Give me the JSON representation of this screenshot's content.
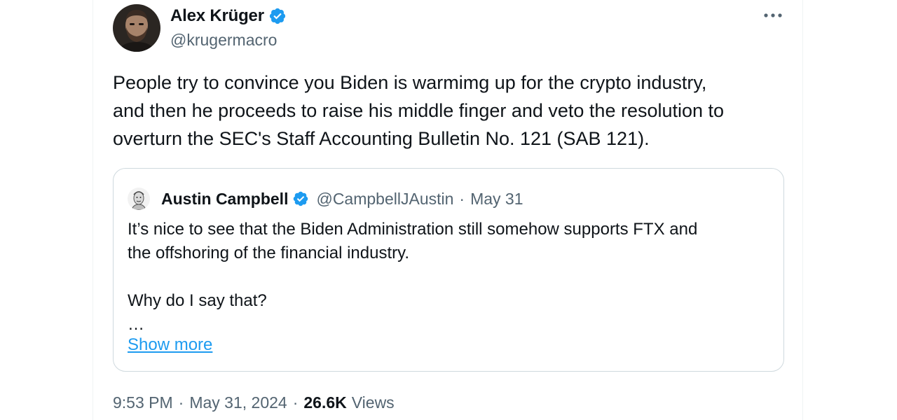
{
  "author": {
    "name": "Alex Krüger",
    "handle": "@krugermacro",
    "verified": true,
    "avatar_icon": "person-avatar-icon"
  },
  "tweet": {
    "text": "People try to convince you Biden is warmimg up for the crypto industry,\nand then he proceeds to raise his middle finger and veto the resolution to\noverturn the SEC's Staff Accounting Bulletin No. 121 (SAB 121)."
  },
  "quote": {
    "name": "Austin Campbell",
    "handle": "@CampbellJAustin",
    "separator": "·",
    "date": "May 31",
    "verified": true,
    "text": "It’s nice to see that the Biden Administration still somehow supports FTX and\nthe offshoring of the financial industry.\n\nWhy do I say that?\n…",
    "show_more": "Show more"
  },
  "meta": {
    "time": "9:53 PM",
    "separator": "·",
    "date": "May 31, 2024",
    "views_count": "26.6K",
    "views_label": "Views"
  },
  "colors": {
    "text": "#0f1419",
    "secondary": "#536471",
    "link": "#1d9bf0",
    "border": "#cfd9de",
    "verified": "#1d9bf0"
  }
}
